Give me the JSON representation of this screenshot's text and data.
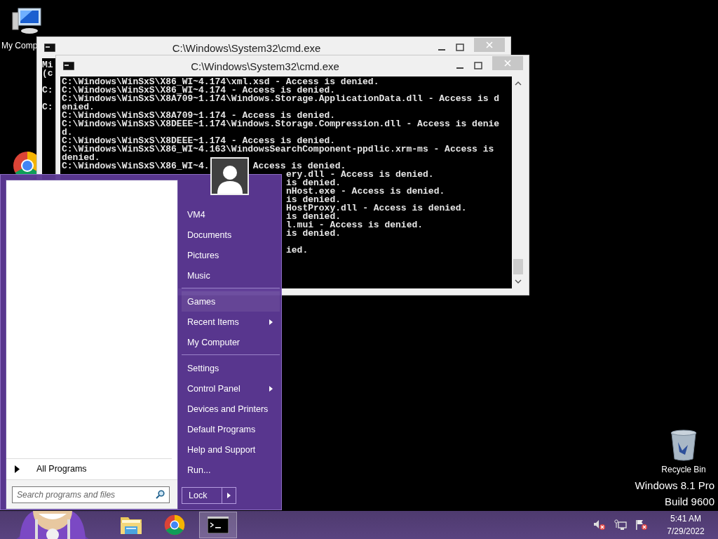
{
  "desktop": {
    "icons": [
      {
        "kind": "computer",
        "label": "My Comp"
      },
      {
        "kind": "chrome"
      },
      {
        "kind": "recycle",
        "label": "Recycle Bin"
      }
    ],
    "watermark": [
      "Windows 8.1 Pro",
      "Build 9600"
    ]
  },
  "back_window": {
    "title": "C:\\Windows\\System32\\cmd.exe",
    "blocks": [
      [
        "Mi",
        "(c"
      ],
      [
        "C:"
      ],
      [
        "C:"
      ]
    ]
  },
  "front_window": {
    "title": "C:\\Windows\\System32\\cmd.exe",
    "blocks": [
      [
        {
          "text": "C:\\Windows\\WinSxS\\X86_WI~4.174\\xml.xsd - Access is denied."
        },
        {
          "text": "C:\\Windows\\WinSxS\\X86_WI~4.174 - Access is denied."
        },
        {
          "text": "C:\\Windows\\WinSxS\\X8A709~1.174\\Windows.Storage.ApplicationData.dll - Access is d"
        },
        {
          "text": "enied."
        },
        {
          "text": "C:\\Windows\\WinSxS\\X8A709~1.174 - Access is denied."
        },
        {
          "text": "C:\\Windows\\WinSxS\\X8DEEE~1.174\\Windows.Storage.Compression.dll - Access is denie"
        },
        {
          "text": "d."
        },
        {
          "text": "C:\\Windows\\WinSxS\\X8DEEE~1.174 - Access is denied."
        },
        {
          "text": "C:\\Windows\\WinSxS\\X86_WI~4.163\\WindowsSearchComponent-ppdlic.xrm-ms - Access is"
        },
        {
          "text": "denied."
        },
        {
          "text": "C:\\Windows\\WinSxS\\X86_WI~4.",
          "tail": "Access is denied."
        },
        {
          "tail": "ery.dll - Access is denied."
        },
        {
          "tail": "is denied."
        },
        {
          "tail": "nHost.exe - Access is denied."
        },
        {
          "tail": "is denied."
        },
        {
          "tail": "HostProxy.dll - Access is denied."
        },
        {
          "tail": "is denied."
        },
        {
          "tail": "l.mui - Access is denied."
        },
        {
          "tail": "is denied."
        }
      ],
      [
        {
          "tail": "ied."
        }
      ]
    ]
  },
  "start_menu": {
    "all_programs": "All Programs",
    "search": {
      "placeholder": "Search programs and files"
    },
    "groups": [
      [
        {
          "label": "VM4",
          "submenu": false,
          "selected": false
        },
        {
          "label": "Documents",
          "submenu": false,
          "selected": false
        },
        {
          "label": "Pictures",
          "submenu": false,
          "selected": false
        },
        {
          "label": "Music",
          "submenu": false,
          "selected": false
        }
      ],
      [
        {
          "label": "Games",
          "submenu": false,
          "selected": true
        },
        {
          "label": "Recent Items",
          "submenu": true,
          "selected": false
        },
        {
          "label": "My Computer",
          "submenu": false,
          "selected": false
        }
      ],
      [
        {
          "label": "Settings",
          "submenu": false,
          "selected": false
        },
        {
          "label": "Control Panel",
          "submenu": true,
          "selected": false
        },
        {
          "label": "Devices and Printers",
          "submenu": false,
          "selected": false
        },
        {
          "label": "Default Programs",
          "submenu": false,
          "selected": false
        },
        {
          "label": "Help and Support",
          "submenu": false,
          "selected": false
        },
        {
          "label": "Run...",
          "submenu": false,
          "selected": false
        }
      ]
    ],
    "lock": "Lock"
  },
  "taskbar": {
    "apps": [
      {
        "kind": "explorer",
        "active": false
      },
      {
        "kind": "chrome",
        "active": false
      },
      {
        "kind": "cmd",
        "active": true
      }
    ],
    "tray": [
      {
        "kind": "speaker"
      },
      {
        "kind": "network"
      },
      {
        "kind": "flag"
      }
    ],
    "clock": {
      "time": "5:41 AM",
      "date": "7/29/2022"
    }
  }
}
